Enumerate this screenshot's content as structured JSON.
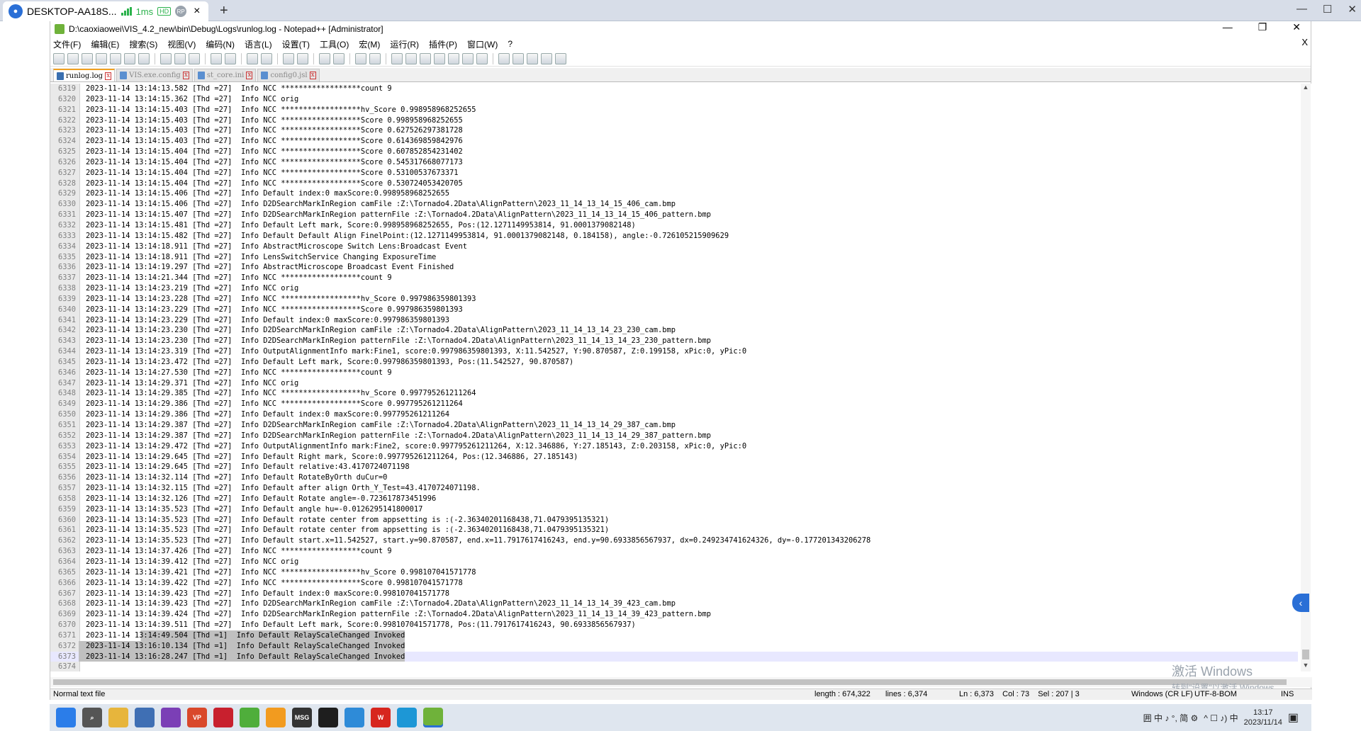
{
  "rdp": {
    "tab_title": "DESKTOP-AA18S...",
    "latency": "1ms",
    "quality_badge": "HD",
    "rp_badge": "RP",
    "close_tab_icon": "×",
    "new_tab_icon": "+",
    "win_controls": {
      "minimize": "—",
      "maximize": "☐",
      "close": "✕"
    }
  },
  "window": {
    "title": "D:\\caoxiaowei\\VIS_4.2_new\\bin\\Debug\\Logs\\runlog.log - Notepad++ [Administrator]",
    "controls": {
      "minimize": "—",
      "restore": "❐",
      "close": "✕"
    },
    "menu_close": "X"
  },
  "menu": [
    "文件(F)",
    "编辑(E)",
    "搜索(S)",
    "视图(V)",
    "编码(N)",
    "语言(L)",
    "设置(T)",
    "工具(O)",
    "宏(M)",
    "运行(R)",
    "插件(P)",
    "窗口(W)",
    "?"
  ],
  "tabs": [
    {
      "label": "runlog.log",
      "active": true
    },
    {
      "label": "VIS.exe.config",
      "active": false
    },
    {
      "label": "st_core.ini",
      "active": false
    },
    {
      "label": "config0.jsl",
      "active": false
    }
  ],
  "lines": [
    {
      "n": "6319",
      "t": "2023-11-14 13:14:13.582 [Thd =27]  Info NCC ******************count 9"
    },
    {
      "n": "6320",
      "t": "2023-11-14 13:14:15.362 [Thd =27]  Info NCC orig"
    },
    {
      "n": "6321",
      "t": "2023-11-14 13:14:15.403 [Thd =27]  Info NCC ******************hv_Score 0.998958968252655"
    },
    {
      "n": "6322",
      "t": "2023-11-14 13:14:15.403 [Thd =27]  Info NCC ******************Score 0.998958968252655"
    },
    {
      "n": "6323",
      "t": "2023-11-14 13:14:15.403 [Thd =27]  Info NCC ******************Score 0.627526297381728"
    },
    {
      "n": "6324",
      "t": "2023-11-14 13:14:15.403 [Thd =27]  Info NCC ******************Score 0.614369859842976"
    },
    {
      "n": "6325",
      "t": "2023-11-14 13:14:15.404 [Thd =27]  Info NCC ******************Score 0.607852854231402"
    },
    {
      "n": "6326",
      "t": "2023-11-14 13:14:15.404 [Thd =27]  Info NCC ******************Score 0.545317668077173"
    },
    {
      "n": "6327",
      "t": "2023-11-14 13:14:15.404 [Thd =27]  Info NCC ******************Score 0.53100537673371"
    },
    {
      "n": "6328",
      "t": "2023-11-14 13:14:15.404 [Thd =27]  Info NCC ******************Score 0.530724053420705"
    },
    {
      "n": "6329",
      "t": "2023-11-14 13:14:15.406 [Thd =27]  Info Default index:0 maxScore:0.998958968252655"
    },
    {
      "n": "6330",
      "t": "2023-11-14 13:14:15.406 [Thd =27]  Info D2DSearchMarkInRegion camFile :Z:\\Tornado4.2Data\\AlignPattern\\2023_11_14_13_14_15_406_cam.bmp"
    },
    {
      "n": "6331",
      "t": "2023-11-14 13:14:15.407 [Thd =27]  Info D2DSearchMarkInRegion patternFile :Z:\\Tornado4.2Data\\AlignPattern\\2023_11_14_13_14_15_406_pattern.bmp"
    },
    {
      "n": "6332",
      "t": "2023-11-14 13:14:15.481 [Thd =27]  Info Default Left mark, Score:0.998958968252655, Pos:(12.1271149953814, 91.0001379082148)"
    },
    {
      "n": "6333",
      "t": "2023-11-14 13:14:15.482 [Thd =27]  Info Default Default Align FinelPoint:(12.1271149953814, 91.0001379082148, 0.184158), angle:-0.726105215909629"
    },
    {
      "n": "6334",
      "t": "2023-11-14 13:14:18.911 [Thd =27]  Info AbstractMicroscope Switch Lens:Broadcast Event"
    },
    {
      "n": "6335",
      "t": "2023-11-14 13:14:18.911 [Thd =27]  Info LensSwitchService Changing ExposureTime"
    },
    {
      "n": "6336",
      "t": "2023-11-14 13:14:19.297 [Thd =27]  Info AbstractMicroscope Broadcast Event Finished"
    },
    {
      "n": "6337",
      "t": "2023-11-14 13:14:21.344 [Thd =27]  Info NCC ******************count 9"
    },
    {
      "n": "6338",
      "t": "2023-11-14 13:14:23.219 [Thd =27]  Info NCC orig"
    },
    {
      "n": "6339",
      "t": "2023-11-14 13:14:23.228 [Thd =27]  Info NCC ******************hv_Score 0.997986359801393"
    },
    {
      "n": "6340",
      "t": "2023-11-14 13:14:23.229 [Thd =27]  Info NCC ******************Score 0.997986359801393"
    },
    {
      "n": "6341",
      "t": "2023-11-14 13:14:23.229 [Thd =27]  Info Default index:0 maxScore:0.997986359801393"
    },
    {
      "n": "6342",
      "t": "2023-11-14 13:14:23.230 [Thd =27]  Info D2DSearchMarkInRegion camFile :Z:\\Tornado4.2Data\\AlignPattern\\2023_11_14_13_14_23_230_cam.bmp"
    },
    {
      "n": "6343",
      "t": "2023-11-14 13:14:23.230 [Thd =27]  Info D2DSearchMarkInRegion patternFile :Z:\\Tornado4.2Data\\AlignPattern\\2023_11_14_13_14_23_230_pattern.bmp"
    },
    {
      "n": "6344",
      "t": "2023-11-14 13:14:23.319 [Thd =27]  Info OutputAlignmentInfo mark:Fine1, score:0.997986359801393, X:11.542527, Y:90.870587, Z:0.199158, xPic:0, yPic:0"
    },
    {
      "n": "6345",
      "t": "2023-11-14 13:14:23.472 [Thd =27]  Info Default Left mark, Score:0.997986359801393, Pos:(11.542527, 90.870587)"
    },
    {
      "n": "6346",
      "t": "2023-11-14 13:14:27.530 [Thd =27]  Info NCC ******************count 9"
    },
    {
      "n": "6347",
      "t": "2023-11-14 13:14:29.371 [Thd =27]  Info NCC orig"
    },
    {
      "n": "6348",
      "t": "2023-11-14 13:14:29.385 [Thd =27]  Info NCC ******************hv_Score 0.997795261211264"
    },
    {
      "n": "6349",
      "t": "2023-11-14 13:14:29.386 [Thd =27]  Info NCC ******************Score 0.997795261211264"
    },
    {
      "n": "6350",
      "t": "2023-11-14 13:14:29.386 [Thd =27]  Info Default index:0 maxScore:0.997795261211264"
    },
    {
      "n": "6351",
      "t": "2023-11-14 13:14:29.387 [Thd =27]  Info D2DSearchMarkInRegion camFile :Z:\\Tornado4.2Data\\AlignPattern\\2023_11_14_13_14_29_387_cam.bmp"
    },
    {
      "n": "6352",
      "t": "2023-11-14 13:14:29.387 [Thd =27]  Info D2DSearchMarkInRegion patternFile :Z:\\Tornado4.2Data\\AlignPattern\\2023_11_14_13_14_29_387_pattern.bmp"
    },
    {
      "n": "6353",
      "t": "2023-11-14 13:14:29.472 [Thd =27]  Info OutputAlignmentInfo mark:Fine2, score:0.997795261211264, X:12.346886, Y:27.185143, Z:0.203158, xPic:0, yPic:0"
    },
    {
      "n": "6354",
      "t": "2023-11-14 13:14:29.645 [Thd =27]  Info Default Right mark, Score:0.997795261211264, Pos:(12.346886, 27.185143)"
    },
    {
      "n": "6355",
      "t": "2023-11-14 13:14:29.645 [Thd =27]  Info Default relative:43.4170724071198"
    },
    {
      "n": "6356",
      "t": "2023-11-14 13:14:32.114 [Thd =27]  Info Default RotateByOrth duCur=0"
    },
    {
      "n": "6357",
      "t": "2023-11-14 13:14:32.115 [Thd =27]  Info Default after align Orth_Y_Test=43.4170724071198."
    },
    {
      "n": "6358",
      "t": "2023-11-14 13:14:32.126 [Thd =27]  Info Default Rotate angle=-0.723617873451996"
    },
    {
      "n": "6359",
      "t": "2023-11-14 13:14:35.523 [Thd =27]  Info Default angle hu=-0.0126295141800017"
    },
    {
      "n": "6360",
      "t": "2023-11-14 13:14:35.523 [Thd =27]  Info Default rotate center from appsetting is :(-2.36340201168438,71.0479395135321)"
    },
    {
      "n": "6361",
      "t": "2023-11-14 13:14:35.523 [Thd =27]  Info Default rotate center from appsetting is :(-2.36340201168438,71.0479395135321)"
    },
    {
      "n": "6362",
      "t": "2023-11-14 13:14:35.523 [Thd =27]  Info Default start.x=11.542527, start.y=90.870587, end.x=11.7917617416243, end.y=90.6933856567937, dx=0.249234741624326, dy=-0.177201343206278"
    },
    {
      "n": "6363",
      "t": "2023-11-14 13:14:37.426 [Thd =27]  Info NCC ******************count 9"
    },
    {
      "n": "6364",
      "t": "2023-11-14 13:14:39.412 [Thd =27]  Info NCC orig"
    },
    {
      "n": "6365",
      "t": "2023-11-14 13:14:39.421 [Thd =27]  Info NCC ******************hv_Score 0.998107041571778"
    },
    {
      "n": "6366",
      "t": "2023-11-14 13:14:39.422 [Thd =27]  Info NCC ******************Score 0.998107041571778"
    },
    {
      "n": "6367",
      "t": "2023-11-14 13:14:39.423 [Thd =27]  Info Default index:0 maxScore:0.998107041571778"
    },
    {
      "n": "6368",
      "t": "2023-11-14 13:14:39.423 [Thd =27]  Info D2DSearchMarkInRegion camFile :Z:\\Tornado4.2Data\\AlignPattern\\2023_11_14_13_14_39_423_cam.bmp"
    },
    {
      "n": "6369",
      "t": "2023-11-14 13:14:39.424 [Thd =27]  Info D2DSearchMarkInRegion patternFile :Z:\\Tornado4.2Data\\AlignPattern\\2023_11_14_13_14_39_423_pattern.bmp"
    },
    {
      "n": "6370",
      "t": "2023-11-14 13:14:39.511 [Thd =27]  Info Default Left mark, Score:0.998107041571778, Pos:(11.7917617416243, 90.6933856567937)"
    },
    {
      "n": "6371",
      "t": "2023-11-14 13:14:49.504 [Thd =1]  Info Default RelayScaleChanged Invoked",
      "sel": "partial"
    },
    {
      "n": "6372",
      "t": "2023-11-14 13:16:10.134 [Thd =1]  Info Default RelayScaleChanged Invoked",
      "sel": "full"
    },
    {
      "n": "6373",
      "t": "2023-11-14 13:16:28.247 [Thd =1]  Info Default RelayScaleChanged Invoked",
      "sel": "full"
    },
    {
      "n": "6374",
      "t": ""
    }
  ],
  "status": {
    "file_type": "Normal text file",
    "length": "length : 674,322",
    "lines": "lines : 6,374",
    "position": "Ln : 6,373    Col : 73    Sel : 207 | 3",
    "eol": "Windows (CR LF)",
    "encoding": "UTF-8-BOM",
    "mode": "INS"
  },
  "watermark": {
    "line1": "激活 Windows",
    "line2": "转到\"设置\"以激活 Windows。"
  },
  "side_button_icon": "‹",
  "taskbar": {
    "apps": [
      {
        "name": "start-icon",
        "label": "",
        "color": "#2b7de9"
      },
      {
        "name": "search-icon",
        "label": "⌕",
        "color": "#555555"
      },
      {
        "name": "file-explorer-icon",
        "label": "",
        "color": "#e7b53c"
      },
      {
        "name": "remote-icon",
        "label": "",
        "color": "#3f6fb4"
      },
      {
        "name": "visual-studio-icon",
        "label": "",
        "color": "#7b3fb6"
      },
      {
        "name": "vp-icon",
        "label": "VP",
        "color": "#d9482b"
      },
      {
        "name": "app-red-icon",
        "label": "",
        "color": "#c8202e"
      },
      {
        "name": "app-green-icon",
        "label": "",
        "color": "#4fae3b"
      },
      {
        "name": "app-search-orange-icon",
        "label": "",
        "color": "#f29b1f"
      },
      {
        "name": "msg-icon",
        "label": "MSG",
        "color": "#333333"
      },
      {
        "name": "terminal-icon",
        "label": "",
        "color": "#1e1e1e"
      },
      {
        "name": "app-blue-icon",
        "label": "",
        "color": "#2e8bd8"
      },
      {
        "name": "wps-icon",
        "label": "W",
        "color": "#d7261e"
      },
      {
        "name": "app-teal-icon",
        "label": "",
        "color": "#1d97d6"
      },
      {
        "name": "notepadpp-icon",
        "label": "",
        "color": "#6fb23a",
        "active": true
      }
    ],
    "tray_text": "囲 中 ♪ °, 简 ⚙",
    "tray_icons": "^  ☐  ♪)  中",
    "time": "13:17",
    "date": "2023/11/14",
    "notify_icon": "▣"
  }
}
